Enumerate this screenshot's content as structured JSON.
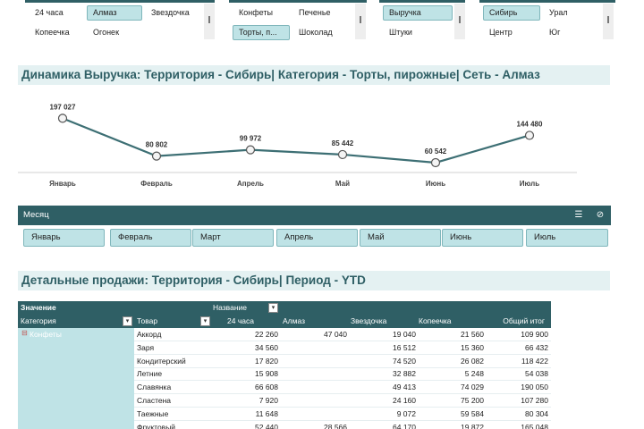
{
  "slicers": {
    "network": {
      "items": [
        "24 часа",
        "Алмаз",
        "Звездочка",
        "Копеечка",
        "Огонек"
      ],
      "selected": [
        "Алмаз"
      ]
    },
    "category": {
      "items": [
        "Конфеты",
        "Печенье",
        "Торты, п...",
        "Шоколад"
      ],
      "selected": [
        "Торты, п..."
      ]
    },
    "measure": {
      "items": [
        "Выручка",
        "Штуки"
      ],
      "selected": [
        "Выручка"
      ]
    },
    "territory": {
      "items": [
        "Сибирь",
        "Урал",
        "Центр",
        "Юг"
      ],
      "selected": [
        "Сибирь"
      ]
    }
  },
  "chart_title": "Динамика Выручка: Территория - Сибирь| Категория - Торты, пирожные| Сеть - Алмаз",
  "chart_data": {
    "type": "line",
    "categories": [
      "Январь",
      "Февраль",
      "Апрель",
      "Май",
      "Июнь",
      "Июль"
    ],
    "values": [
      197027,
      80802,
      99972,
      85442,
      60542,
      144480
    ],
    "labels": [
      "197 027",
      "80 802",
      "99 972",
      "85 442",
      "60 542",
      "144 480"
    ],
    "ylim": [
      0,
      220000
    ],
    "color": "#3d6f74",
    "grid": false
  },
  "month_slicer": {
    "title": "Месяц",
    "multi_select_icon": "multi-select-icon",
    "clear_filter_icon": "clear-filter-icon",
    "items": [
      "Январь",
      "Февраль",
      "Март",
      "Апрель",
      "Май",
      "Июнь",
      "Июль"
    ]
  },
  "table_title": "Детальные продажи: Территория - Сибирь| Период - YTD",
  "pivot": {
    "values_label": "Значение",
    "columns_label": "Название",
    "rows_label": "Категория",
    "product_label": "Товар",
    "columns": [
      "24 часа",
      "Алмаз",
      "Звездочка",
      "Копеечка",
      "Общий итог"
    ],
    "category": "Конфеты",
    "collapse_symbol": "⊟",
    "rows": [
      {
        "name": "Аккорд",
        "values": [
          "22 260",
          "47 040",
          "19 040",
          "21 560",
          "109 900"
        ]
      },
      {
        "name": "Заря",
        "values": [
          "34 560",
          "",
          "16 512",
          "15 360",
          "66 432"
        ]
      },
      {
        "name": "Кондитерский",
        "values": [
          "17 820",
          "",
          "74 520",
          "26 082",
          "118 422"
        ]
      },
      {
        "name": "Летние",
        "values": [
          "15 908",
          "",
          "32 882",
          "5 248",
          "54 038"
        ]
      },
      {
        "name": "Славянка",
        "values": [
          "66 608",
          "",
          "49 413",
          "74 029",
          "190 050"
        ]
      },
      {
        "name": "Сластена",
        "values": [
          "7 920",
          "",
          "24 160",
          "75 200",
          "107 280"
        ]
      },
      {
        "name": "Таежные",
        "values": [
          "11 648",
          "",
          "9 072",
          "59 584",
          "80 304"
        ]
      },
      {
        "name": "Фруктовый",
        "values": [
          "52 440",
          "28 566",
          "64 170",
          "19 872",
          "165 048"
        ]
      }
    ]
  },
  "colors": {
    "accent": "#2f5f65",
    "selected": "#bfe3e6",
    "banner": "#e4f1f2"
  }
}
